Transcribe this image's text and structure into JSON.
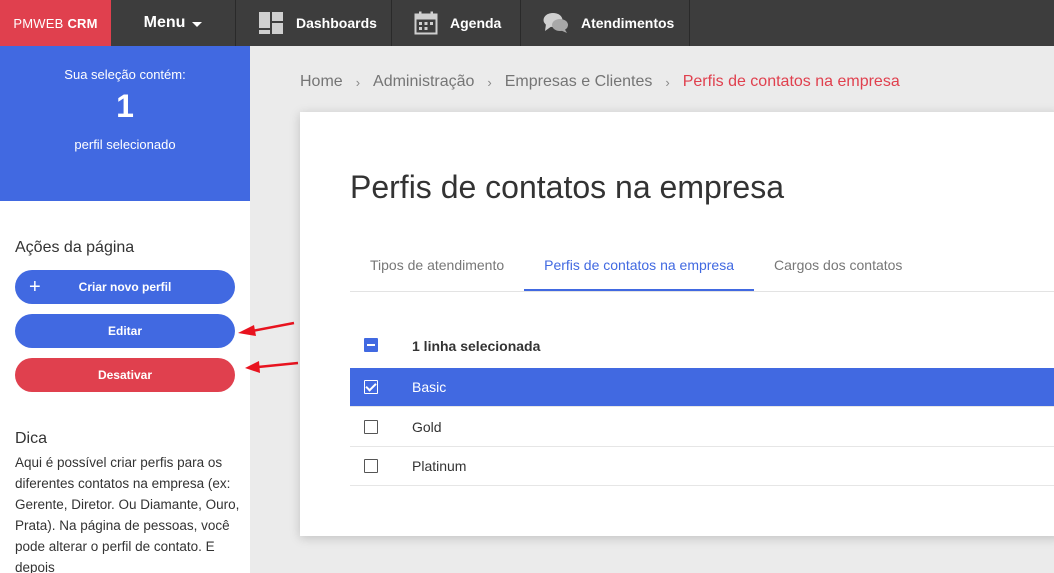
{
  "topbar": {
    "brand_prefix": "PMWEB",
    "brand_suffix": "CRM",
    "menu_label": "Menu",
    "nav": [
      {
        "label": "Dashboards",
        "icon": "dashboard-icon"
      },
      {
        "label": "Agenda",
        "icon": "calendar-icon"
      },
      {
        "label": "Atendimentos",
        "icon": "chat-icon"
      }
    ]
  },
  "selection": {
    "label": "Sua seleção contém:",
    "count": "1",
    "sub": "perfil selecionado"
  },
  "actions": {
    "title": "Ações da página",
    "create_label": "Criar novo perfil",
    "edit_label": "Editar",
    "deactivate_label": "Desativar"
  },
  "tip": {
    "title": "Dica",
    "text": "Aqui é possível criar perfis para os diferentes contatos na empresa (ex: Gerente, Diretor. Ou Diamante, Ouro, Prata). Na página de pessoas, você pode alterar o perfil de contato. E depois"
  },
  "breadcrumb": {
    "items": [
      "Home",
      "Administração",
      "Empresas e Clientes"
    ],
    "current": "Perfis de contatos na empresa"
  },
  "page": {
    "title": "Perfis de contatos na empresa",
    "tabs": [
      {
        "label": "Tipos de atendimento",
        "active": false
      },
      {
        "label": "Perfis de contatos na empresa",
        "active": true
      },
      {
        "label": "Cargos dos contatos",
        "active": false
      }
    ]
  },
  "table": {
    "header_label": "1 linha selecionada",
    "rows": [
      {
        "label": "Basic",
        "selected": true
      },
      {
        "label": "Gold",
        "selected": false
      },
      {
        "label": "Platinum",
        "selected": false
      }
    ]
  },
  "colors": {
    "accent_blue": "#4169e1",
    "accent_red": "#e0404e",
    "topbar": "#3d3d3d"
  }
}
